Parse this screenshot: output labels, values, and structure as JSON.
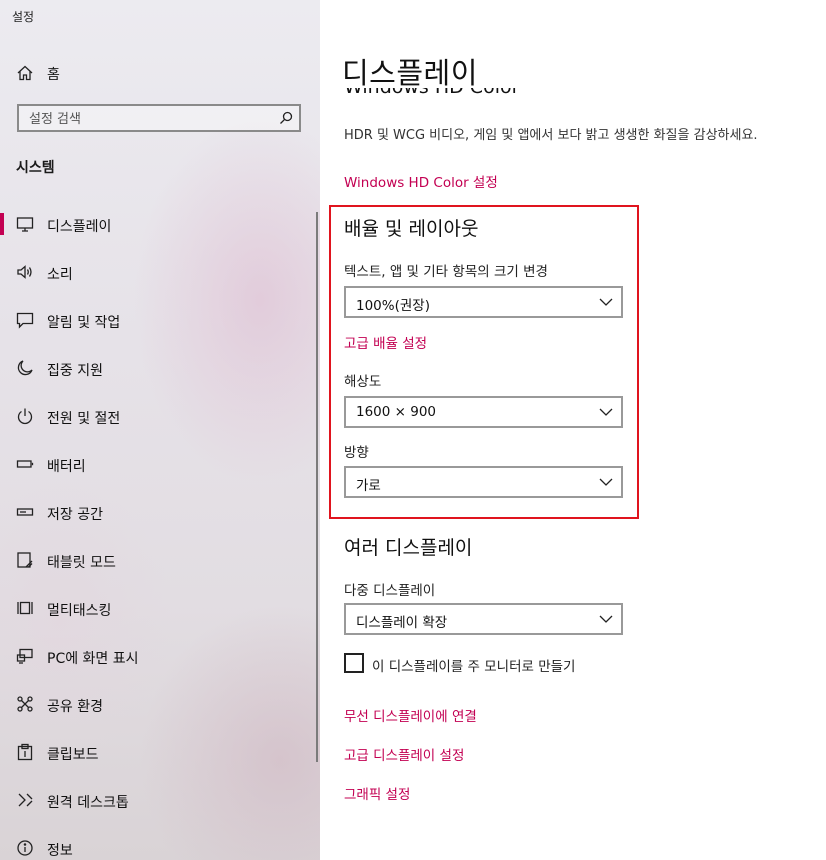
{
  "sidebar": {
    "app_title": "설정",
    "home_label": "홈",
    "search_placeholder": "설정 검색",
    "section_title": "시스템",
    "items": [
      {
        "label": "디스플레이",
        "icon": "monitor-icon",
        "active": true
      },
      {
        "label": "소리",
        "icon": "speaker-icon"
      },
      {
        "label": "알림 및 작업",
        "icon": "notification-icon"
      },
      {
        "label": "집중 지원",
        "icon": "moon-icon"
      },
      {
        "label": "전원 및 절전",
        "icon": "power-icon"
      },
      {
        "label": "배터리",
        "icon": "battery-icon"
      },
      {
        "label": "저장 공간",
        "icon": "storage-icon"
      },
      {
        "label": "태블릿 모드",
        "icon": "tablet-icon"
      },
      {
        "label": "멀티태스킹",
        "icon": "multitasking-icon"
      },
      {
        "label": "PC에 화면 표시",
        "icon": "project-icon"
      },
      {
        "label": "공유 환경",
        "icon": "share-icon"
      },
      {
        "label": "클립보드",
        "icon": "clipboard-icon"
      },
      {
        "label": "원격 데스크톱",
        "icon": "remote-desktop-icon"
      },
      {
        "label": "정보",
        "icon": "info-icon"
      }
    ]
  },
  "main": {
    "page_title": "디스플레이",
    "hd_color_heading": "Windows HD Color",
    "hd_color_desc": "HDR 및 WCG 비디오, 게임 및 앱에서 보다 밝고 생생한 화질을 감상하세요.",
    "hd_color_link": "Windows HD Color 설정",
    "scale_layout": {
      "heading": "배율 및 레이아웃",
      "scale_label": "텍스트, 앱 및 기타 항목의 크기 변경",
      "scale_value": "100%(권장)",
      "advanced_scaling_link": "고급 배율 설정",
      "resolution_label": "해상도",
      "resolution_value": "1600 × 900",
      "orientation_label": "방향",
      "orientation_value": "가로"
    },
    "multi_display": {
      "heading": "여러 디스플레이",
      "label": "다중 디스플레이",
      "value": "디스플레이 확장",
      "main_display_checkbox": "이 디스플레이를 주 모니터로 만들기",
      "checkbox_checked": false,
      "wireless_link": "무선 디스플레이에 연결",
      "advanced_display_link": "고급 디스플레이 설정",
      "graphics_link": "그래픽 설정"
    },
    "accent_color": "#c30052",
    "highlight_color": "#e0141e"
  }
}
